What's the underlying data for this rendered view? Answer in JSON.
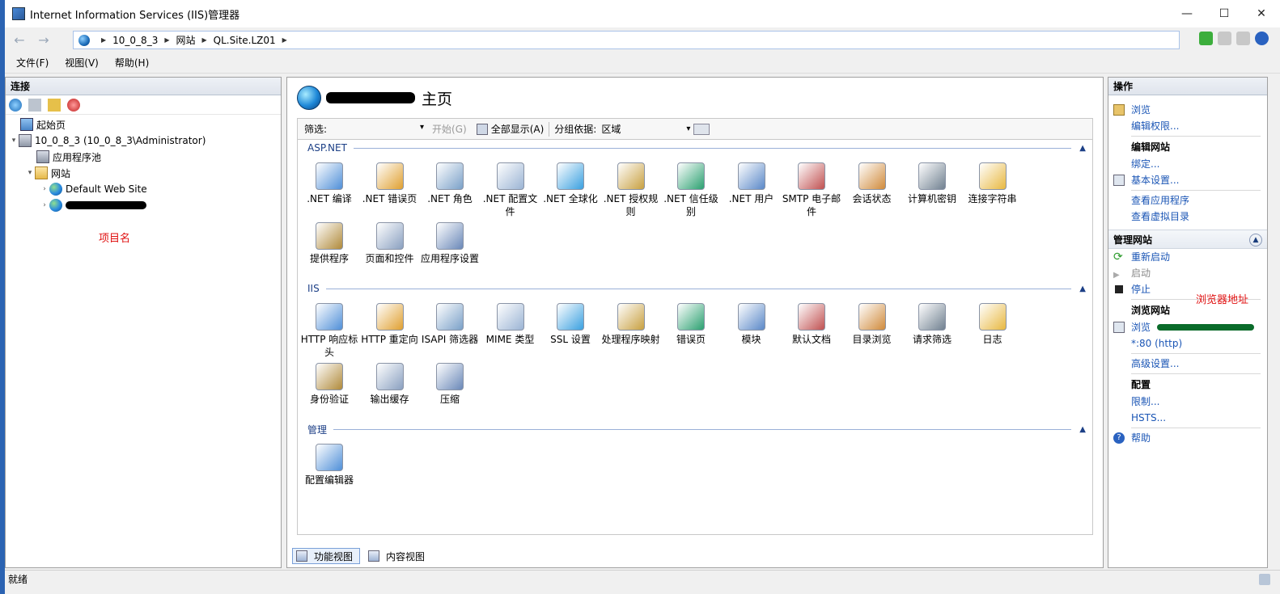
{
  "window": {
    "title": "Internet Information Services (IIS)管理器"
  },
  "address": {
    "crumbs": [
      "10_0_8_3",
      "网站",
      "QL.Site.LZ01"
    ]
  },
  "menu": [
    "文件(F)",
    "视图(V)",
    "帮助(H)"
  ],
  "connections": {
    "header": "连接",
    "tree": {
      "start": "起始页",
      "server": "10_0_8_3 (10_0_8_3\\Administrator)",
      "app_pools": "应用程序池",
      "sites": "网站",
      "default_site": "Default Web Site"
    },
    "annotation": "项目名"
  },
  "center": {
    "title": "主页",
    "filter_label": "筛选:",
    "go_label": "开始(G)",
    "show_all": "全部显示(A)",
    "group_label": "分组依据:",
    "group_value": "区域",
    "sections": {
      "aspnet": "ASP.NET",
      "iis": "IIS",
      "manage": "管理"
    },
    "aspnet_items": [
      ".NET 编译",
      ".NET 错误页",
      ".NET 角色",
      ".NET 配置文件",
      ".NET 全球化",
      ".NET 授权规则",
      ".NET 信任级别",
      ".NET 用户",
      "SMTP 电子邮件",
      "会话状态",
      "计算机密钥",
      "连接字符串",
      "提供程序",
      "页面和控件",
      "应用程序设置"
    ],
    "iis_items": [
      "HTTP 响应标头",
      "HTTP 重定向",
      "ISAPI 筛选器",
      "MIME 类型",
      "SSL 设置",
      "处理程序映射",
      "错误页",
      "模块",
      "默认文档",
      "目录浏览",
      "请求筛选",
      "日志",
      "身份验证",
      "输出缓存",
      "压缩"
    ],
    "manage_items": [
      "配置编辑器"
    ],
    "tabs": {
      "features": "功能视图",
      "content": "内容视图"
    }
  },
  "actions": {
    "header": "操作",
    "browse": "浏览",
    "edit_perms": "编辑权限...",
    "edit_site": "编辑网站",
    "bindings": "绑定...",
    "basic_settings": "基本设置...",
    "view_apps": "查看应用程序",
    "view_vdirs": "查看虚拟目录",
    "manage_site": "管理网站",
    "restart": "重新启动",
    "start": "启动",
    "stop": "停止",
    "browse_site": "浏览网站",
    "browse_short": "浏览",
    "browse_port": "*:80 (http)",
    "advanced": "高级设置...",
    "config": "配置",
    "limits": "限制...",
    "hsts": "HSTS...",
    "help": "帮助",
    "annotation": "浏览器地址"
  },
  "status": {
    "text": "就绪"
  },
  "colors": {
    "accent": "#1a55b5",
    "annotation": "#e01010",
    "frame": "#2b63b2"
  }
}
